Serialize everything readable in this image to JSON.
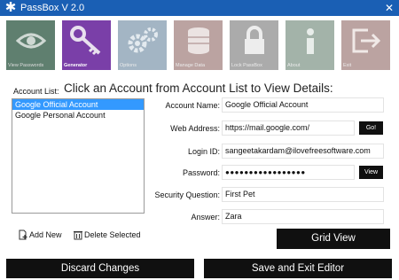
{
  "window": {
    "title": "PassBox V 2.0",
    "close_glyph": "✕"
  },
  "toolbar": {
    "buttons": [
      {
        "label": "View Passwords",
        "icon": "eye-icon",
        "color": "#5f7f6f"
      },
      {
        "label": "Generator",
        "icon": "key-icon",
        "color": "#7a3fa8"
      },
      {
        "label": "Options",
        "icon": "gear-icon",
        "color": "#4a6e8a"
      },
      {
        "label": "Manage Data",
        "icon": "database-icon",
        "color": "#7a4a46"
      },
      {
        "label": "Lock PassBox",
        "icon": "lock-icon",
        "color": "#5a5a5a"
      },
      {
        "label": "About",
        "icon": "info-icon",
        "color": "#4a6a55"
      },
      {
        "label": "Exit",
        "icon": "exit-icon",
        "color": "#7a4a46"
      }
    ]
  },
  "account_list": {
    "label": "Account List:",
    "items": [
      "Google Official Account",
      "Google Personal Account"
    ],
    "selected_index": 0
  },
  "headline": "Click an Account from Account List to View Details:",
  "details": {
    "account_name": {
      "label": "Account Name:",
      "value": "Google Official Account"
    },
    "web_address": {
      "label": "Web Address:",
      "value": "https://mail.google.com/",
      "button": "Go!"
    },
    "login_id": {
      "label": "Login ID:",
      "value": "sangeetakardam@ilovefreesoftware.com"
    },
    "password": {
      "label": "Password:",
      "value": "●●●●●●●●●●●●●●●●●",
      "button": "View"
    },
    "security_question": {
      "label": "Security Question:",
      "value": "First Pet"
    },
    "answer": {
      "label": "Answer:",
      "value": "Zara"
    }
  },
  "actions": {
    "add_new": "Add New",
    "delete_selected": "Delete Selected",
    "grid_view": "Grid View"
  },
  "footer": {
    "discard": "Discard Changes",
    "save_exit": "Save and Exit Editor"
  },
  "colors": {
    "titlebar": "#1a5fb4",
    "selection": "#3399ff",
    "button_dark": "#101010"
  }
}
